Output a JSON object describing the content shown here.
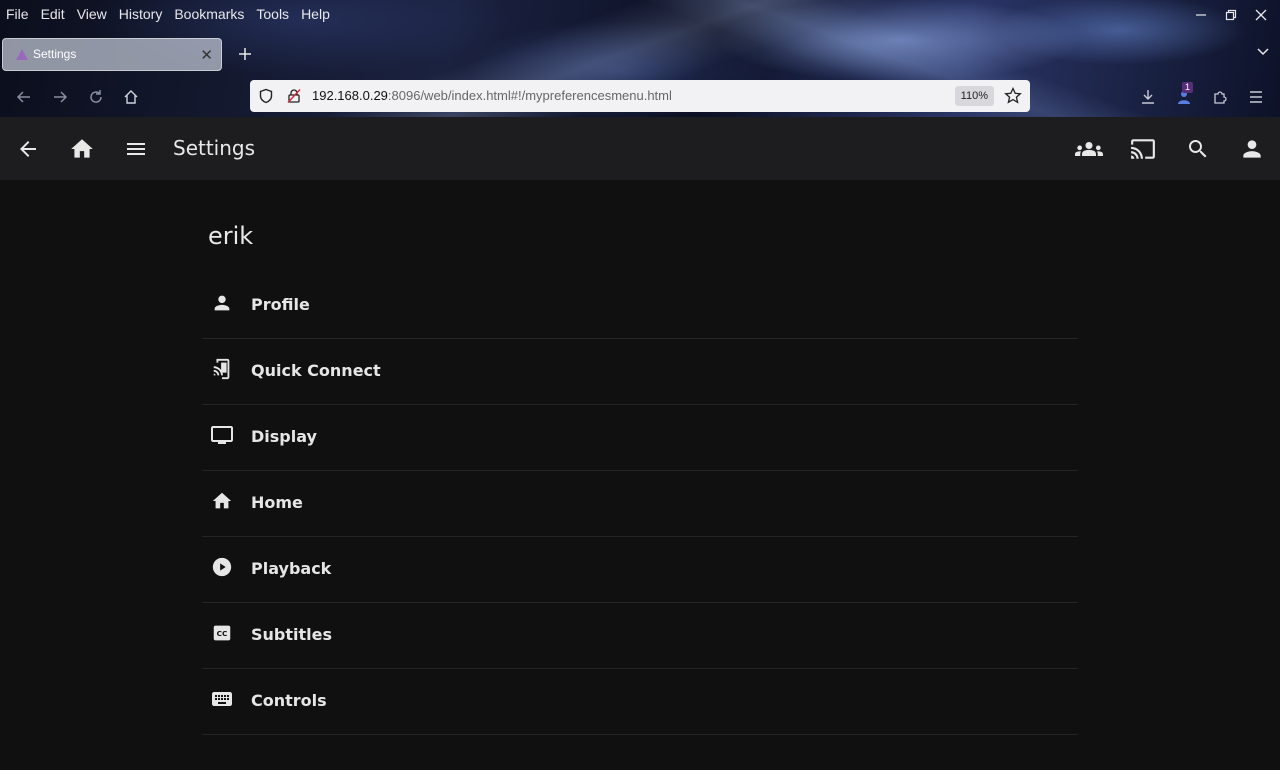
{
  "browser": {
    "menu": [
      "File",
      "Edit",
      "View",
      "History",
      "Bookmarks",
      "Tools",
      "Help"
    ],
    "tab_title": "Settings",
    "url_host": "192.168.0.29",
    "url_rest": ":8096/web/index.html#!/mypreferencesmenu.html",
    "zoom": "110%",
    "extension_badge": "1"
  },
  "app": {
    "title": "Settings",
    "header_icons": [
      "back-arrow-icon",
      "home-icon",
      "hamburger-menu-icon",
      "users-group-icon",
      "cast-icon",
      "search-icon",
      "user-icon"
    ]
  },
  "user": {
    "name": "erik"
  },
  "menu": {
    "items": [
      {
        "label": "Profile",
        "icon": "person-icon"
      },
      {
        "label": "Quick Connect",
        "icon": "phonelink-icon"
      },
      {
        "label": "Display",
        "icon": "monitor-icon"
      },
      {
        "label": "Home",
        "icon": "home-icon"
      },
      {
        "label": "Playback",
        "icon": "play-circle-icon"
      },
      {
        "label": "Subtitles",
        "icon": "closed-caption-icon"
      },
      {
        "label": "Controls",
        "icon": "keyboard-icon"
      }
    ]
  },
  "colors": {
    "page_bg": "#101010",
    "header_bg": "#1d1c1e",
    "text": "#e6e6e6",
    "divider": "#252527"
  }
}
